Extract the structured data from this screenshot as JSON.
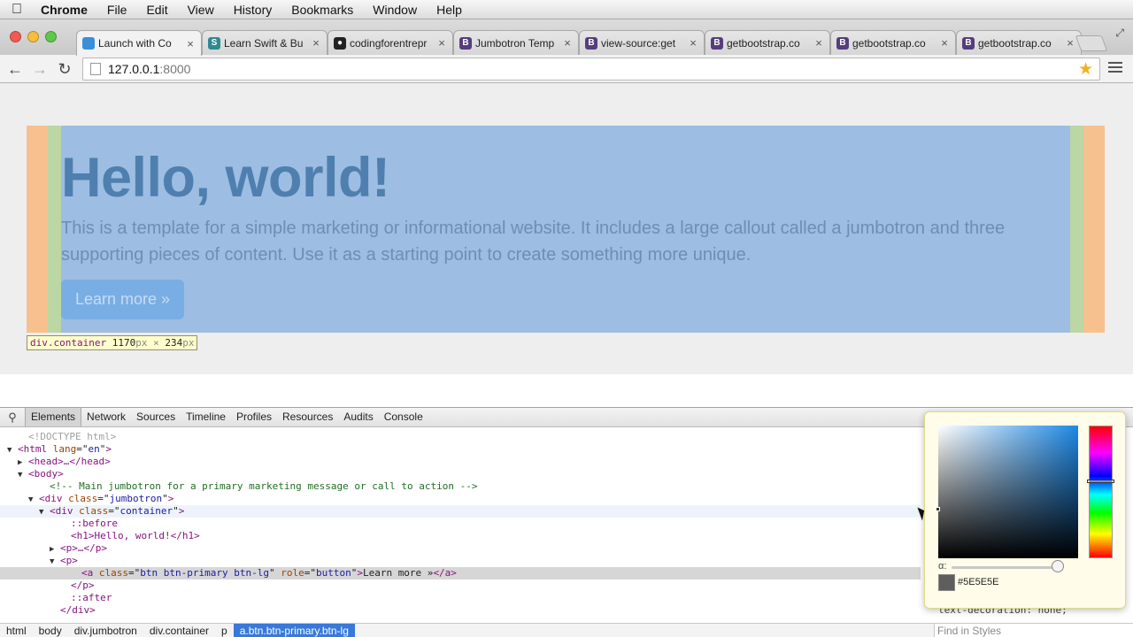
{
  "menubar": {
    "app": "Chrome",
    "items": [
      "File",
      "Edit",
      "View",
      "History",
      "Bookmarks",
      "Window",
      "Help"
    ]
  },
  "tabs": [
    {
      "title": "Launch with Co",
      "icon": "blue-page-icon",
      "color": "#3a8fd9",
      "active": true
    },
    {
      "title": "Learn Swift & Bu",
      "icon": "swift-icon",
      "color": "#2f8a8f"
    },
    {
      "title": "codingforentrepr",
      "icon": "github-icon",
      "color": "#222222"
    },
    {
      "title": "Jumbotron Temp",
      "icon": "bootstrap-icon",
      "color": "#563d7c"
    },
    {
      "title": "view-source:get",
      "icon": "bootstrap-icon",
      "color": "#563d7c"
    },
    {
      "title": "getbootstrap.co",
      "icon": "bootstrap-icon",
      "color": "#563d7c"
    },
    {
      "title": "getbootstrap.co",
      "icon": "bootstrap-icon",
      "color": "#563d7c"
    },
    {
      "title": "getbootstrap.co",
      "icon": "bootstrap-icon",
      "color": "#563d7c"
    }
  ],
  "omnibox": {
    "host": "127.0.0.1",
    "port": ":8000"
  },
  "page": {
    "title": "Hello, world!",
    "text": "This is a template for a simple marketing or informational website. It includes a large callout called a jumbotron and three supporting pieces of content. Use it as a starting point to create something more unique.",
    "button": "Learn more »"
  },
  "tooltip": {
    "tag": "div.container",
    "width": "1170",
    "height": "234",
    "unit": "px",
    "times": "×"
  },
  "devtools": {
    "tabs": [
      "Elements",
      "Network",
      "Sources",
      "Timeline",
      "Profiles",
      "Resources",
      "Audits",
      "Console"
    ],
    "active_tab": "Elements",
    "breadcrumbs": [
      "html",
      "body",
      "div.jumbotron",
      "div.container",
      "p",
      "a.btn.btn-primary.btn-lg"
    ],
    "find_placeholder": "Find in Styles",
    "styles_peek": "text-decoration: none;"
  },
  "dom": [
    {
      "indent": 1,
      "tri": "",
      "html": "doctype",
      "text": "<!DOCTYPE html>"
    },
    {
      "indent": 0,
      "tri": "▼",
      "tag": "html",
      "attrs": [
        [
          "lang",
          "en"
        ]
      ],
      "tail": ""
    },
    {
      "indent": 1,
      "tri": "▶",
      "raw": "<head>…</head>"
    },
    {
      "indent": 1,
      "tri": "▼",
      "raw": "<body>"
    },
    {
      "indent": 3,
      "tri": "",
      "comment": "<!-- Main jumbotron for a primary marketing message or call to action -->"
    },
    {
      "indent": 2,
      "tri": "▼",
      "tag": "div",
      "attrs": [
        [
          "class",
          "jumbotron"
        ]
      ]
    },
    {
      "indent": 3,
      "tri": "▼",
      "tag": "div",
      "attrs": [
        [
          "class",
          "container"
        ]
      ],
      "state": "hover"
    },
    {
      "indent": 5,
      "tri": "",
      "pseudo": "::before"
    },
    {
      "indent": 5,
      "tri": "",
      "raw": "<h1>Hello, world!</h1>"
    },
    {
      "indent": 4,
      "tri": "▶",
      "raw": "<p>…</p>"
    },
    {
      "indent": 4,
      "tri": "▼",
      "raw": "<p>"
    },
    {
      "indent": 6,
      "tri": "",
      "tag": "a",
      "attrs": [
        [
          "class",
          "btn btn-primary btn-lg"
        ],
        [
          "role",
          "button"
        ]
      ],
      "inner": "Learn more »",
      "close": "</a>",
      "state": "selected"
    },
    {
      "indent": 5,
      "tri": "",
      "raw": "</p>"
    },
    {
      "indent": 5,
      "tri": "",
      "pseudo": "::after"
    },
    {
      "indent": 4,
      "tri": "",
      "raw": "</div>"
    }
  ],
  "color_picker": {
    "hex": "#5E5E5E",
    "alpha_label": "α:",
    "swatch": "#5e5e5e"
  }
}
